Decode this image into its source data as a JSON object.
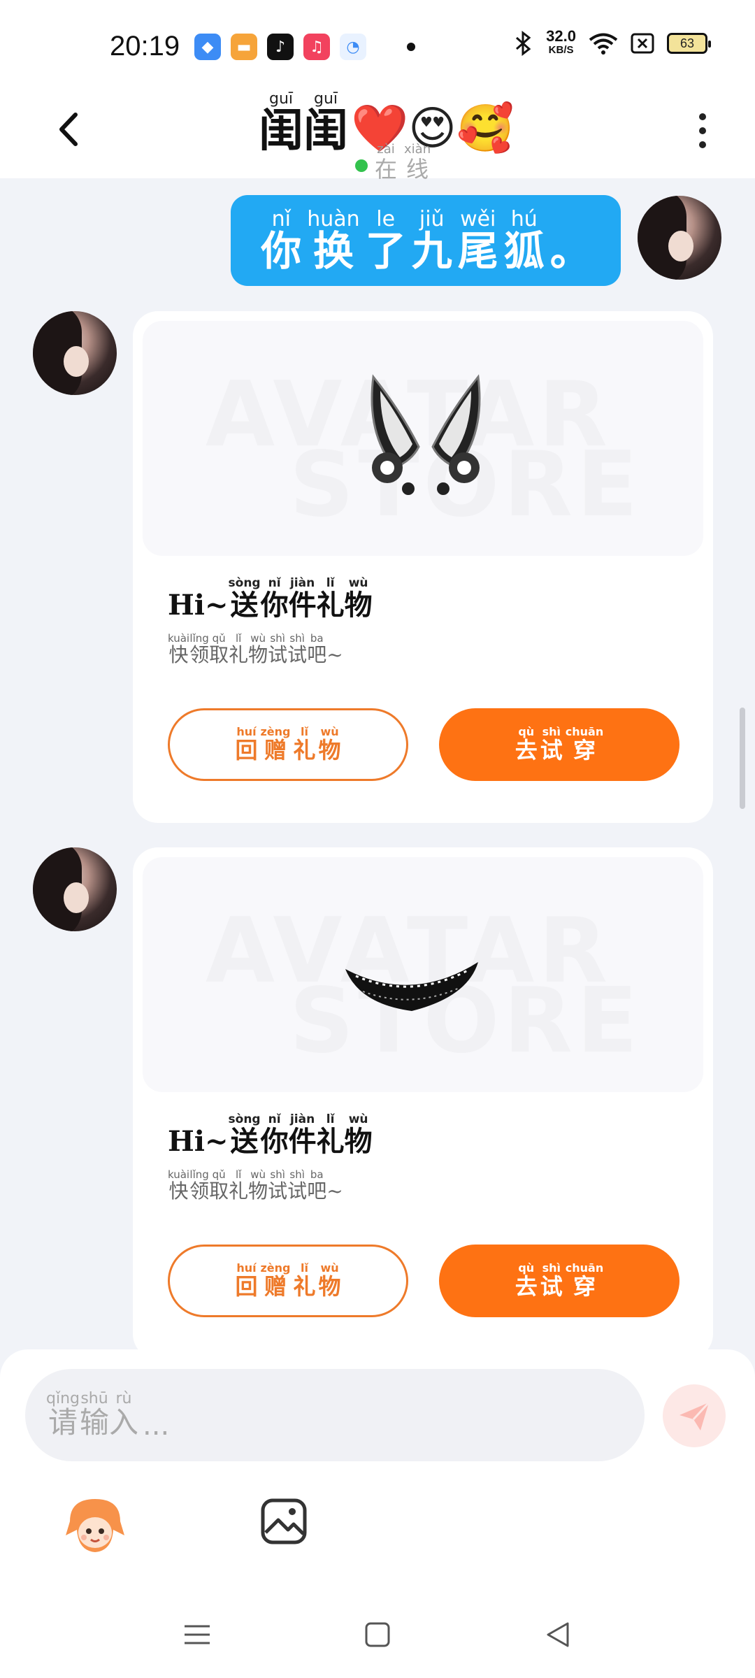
{
  "status_bar": {
    "time": "20:19",
    "net_speed_value": "32.0",
    "net_speed_unit": "KB/S",
    "battery": "63"
  },
  "header": {
    "title_chars": [
      {
        "py": "guī",
        "hz": "闺"
      },
      {
        "py": "guī",
        "hz": "闺"
      }
    ],
    "title_emoji": "❤️😍🥰",
    "status": [
      {
        "py": "zài",
        "hz": "在"
      },
      {
        "py": "xiàn",
        "hz": "线"
      }
    ]
  },
  "message_sent": [
    {
      "py": "nǐ",
      "hz": "你"
    },
    {
      "py": "huàn",
      "hz": "换"
    },
    {
      "py": "le",
      "hz": "了"
    },
    {
      "py": "jiǔ",
      "hz": "九"
    },
    {
      "py": "wěi",
      "hz": "尾"
    },
    {
      "py": "hú",
      "hz": "狐"
    },
    {
      "py": "",
      "hz": "。"
    }
  ],
  "gift_cards": [
    {
      "watermark_top": "AVATAR",
      "watermark_bottom": "STORE",
      "title_lead": "Hi~",
      "title": [
        {
          "py": "sòng",
          "hz": "送"
        },
        {
          "py": "nǐ",
          "hz": "你"
        },
        {
          "py": "jiàn",
          "hz": "件"
        },
        {
          "py": "lǐ",
          "hz": "礼"
        },
        {
          "py": "wù",
          "hz": "物"
        }
      ],
      "subtitle": [
        {
          "py": "kuài",
          "hz": "快"
        },
        {
          "py": "lǐng",
          "hz": "领"
        },
        {
          "py": "qǔ",
          "hz": "取"
        },
        {
          "py": "lǐ",
          "hz": "礼"
        },
        {
          "py": "wù",
          "hz": "物"
        },
        {
          "py": "shì",
          "hz": "试"
        },
        {
          "py": "shì",
          "hz": "试"
        },
        {
          "py": "ba",
          "hz": "吧"
        }
      ],
      "subtitle_tail": "~",
      "return_gift": [
        {
          "py": "huí",
          "hz": "回"
        },
        {
          "py": "zèng",
          "hz": "赠"
        },
        {
          "py": "lǐ",
          "hz": "礼"
        },
        {
          "py": "wù",
          "hz": "物"
        }
      ],
      "try_on": [
        {
          "py": "qù",
          "hz": "去"
        },
        {
          "py": "shì",
          "hz": "试"
        },
        {
          "py": "chuān",
          "hz": "穿"
        }
      ],
      "item_icon": "fox-ears-headband-icon"
    },
    {
      "watermark_top": "AVATAR",
      "watermark_bottom": "STORE",
      "title_lead": "Hi~",
      "title": [
        {
          "py": "sòng",
          "hz": "送"
        },
        {
          "py": "nǐ",
          "hz": "你"
        },
        {
          "py": "jiàn",
          "hz": "件"
        },
        {
          "py": "lǐ",
          "hz": "礼"
        },
        {
          "py": "wù",
          "hz": "物"
        }
      ],
      "subtitle": [
        {
          "py": "kuài",
          "hz": "快"
        },
        {
          "py": "lǐng",
          "hz": "领"
        },
        {
          "py": "qǔ",
          "hz": "取"
        },
        {
          "py": "lǐ",
          "hz": "礼"
        },
        {
          "py": "wù",
          "hz": "物"
        },
        {
          "py": "shì",
          "hz": "试"
        },
        {
          "py": "shì",
          "hz": "试"
        },
        {
          "py": "ba",
          "hz": "吧"
        }
      ],
      "subtitle_tail": "~",
      "return_gift": [
        {
          "py": "huí",
          "hz": "回"
        },
        {
          "py": "zèng",
          "hz": "赠"
        },
        {
          "py": "lǐ",
          "hz": "礼"
        },
        {
          "py": "wù",
          "hz": "物"
        }
      ],
      "try_on": [
        {
          "py": "qù",
          "hz": "去"
        },
        {
          "py": "shì",
          "hz": "试"
        },
        {
          "py": "chuān",
          "hz": "穿"
        }
      ],
      "item_icon": "lace-choker-icon"
    }
  ],
  "input": {
    "placeholder": [
      {
        "py": "qǐng",
        "hz": "请"
      },
      {
        "py": "shū",
        "hz": "输"
      },
      {
        "py": "rù",
        "hz": "入"
      }
    ],
    "placeholder_tail": "..."
  },
  "colors": {
    "accent_orange": "#fe7213",
    "bubble_blue": "#22a9f3",
    "online_green": "#33c24d"
  }
}
